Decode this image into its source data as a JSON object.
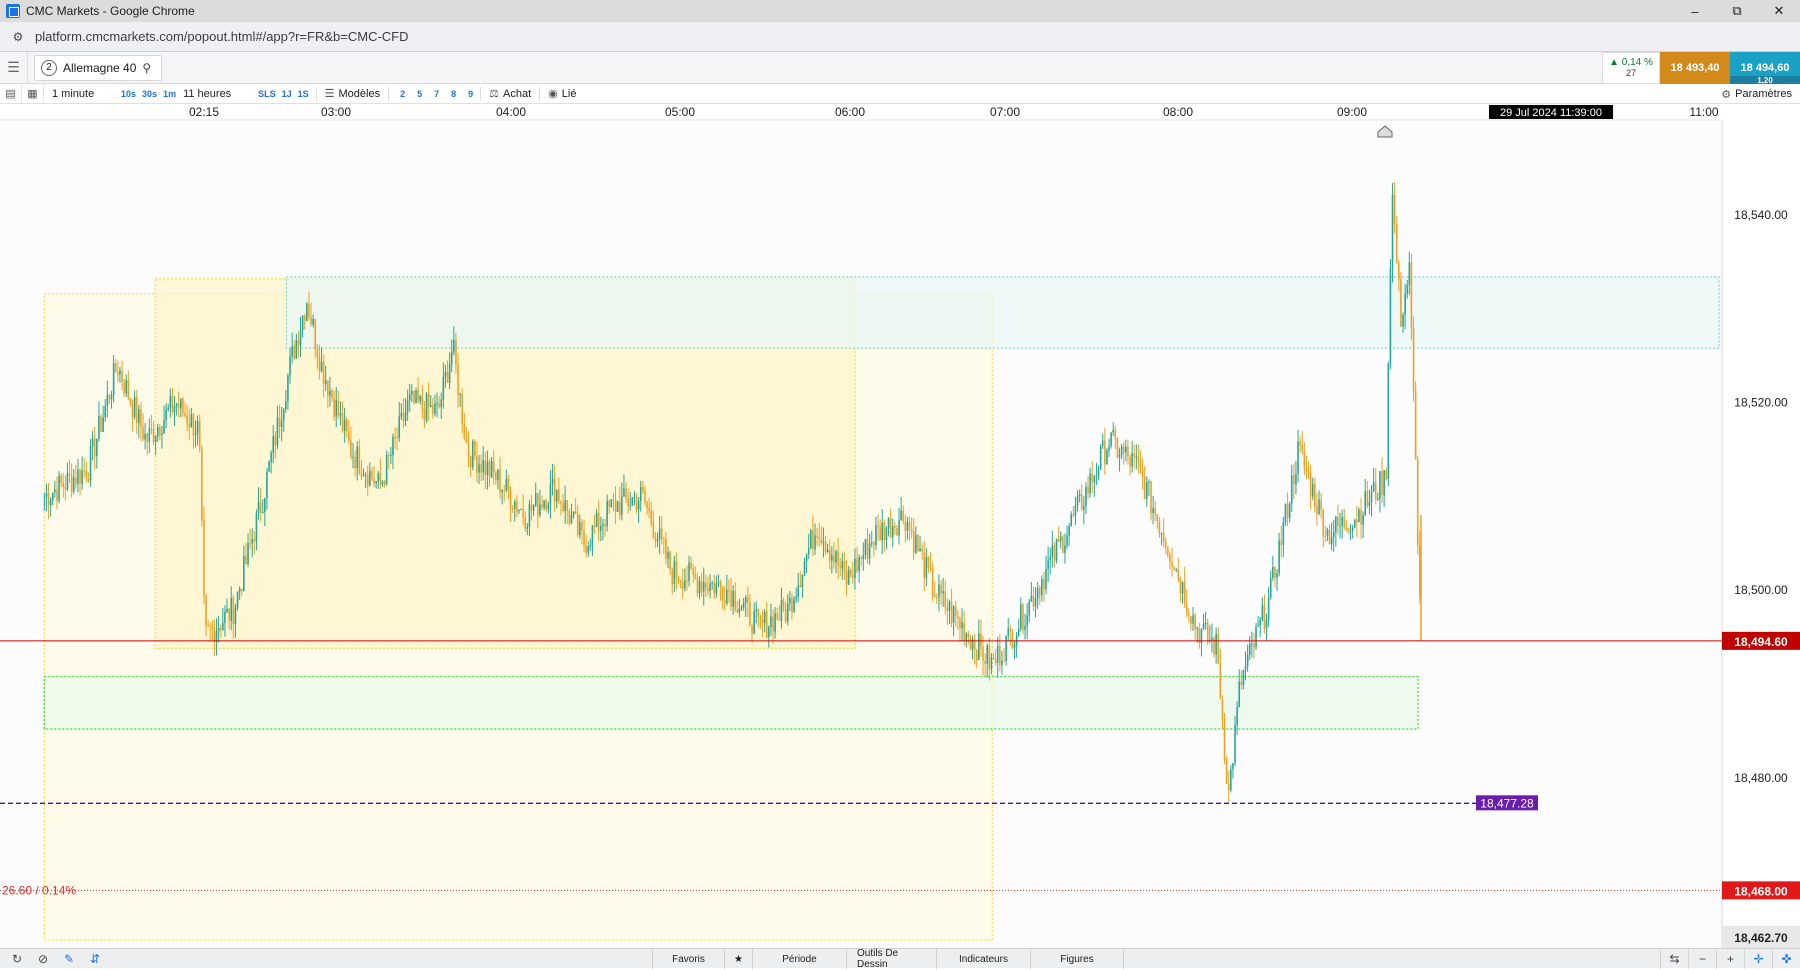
{
  "window": {
    "title": "CMC Markets - Google Chrome",
    "url": "platform.cmcmarkets.com/popout.html#/app?r=FR&b=CMC-CFD"
  },
  "instrument": {
    "tab_number": "2",
    "name": "Allemagne 40",
    "change_pct": "▲ 0,14 %",
    "change_pts": "27",
    "sell_price": "18 493,40",
    "buy_price": "18 494,60",
    "spread": "1,20"
  },
  "toolbar": {
    "interval": "1 minute",
    "quick_intervals": [
      "10s",
      "30s",
      "1m"
    ],
    "timespan": "11 heures",
    "quick_spans": [
      "SLS",
      "1J",
      "1S"
    ],
    "templates_label": "Modèles",
    "layouts": [
      "2",
      "5",
      "7",
      "8",
      "9"
    ],
    "buy_label": "Achat",
    "linked_label": "Lié",
    "settings_label": "Paramètres"
  },
  "bottombar": {
    "tabs": [
      "Favoris",
      "Période",
      "Outils De Dessin",
      "Indicateurs",
      "Figures"
    ]
  },
  "colors": {
    "bull": "#26a69a",
    "bear": "#f0a020",
    "current_price_line": "#cc0000",
    "dashed_level": "#5a0aa0",
    "target_line": "#e03030"
  },
  "chart_data": {
    "type": "candlestick",
    "x_ticks": [
      "02:15",
      "03:00",
      "04:00",
      "05:00",
      "06:00",
      "07:00",
      "08:00",
      "09:00",
      "11:00"
    ],
    "crosshair_time": "29 Jul 2024 11:39:00",
    "y_ticks": [
      "18,540.00",
      "18,520.00",
      "18,500.00",
      "18,480.00"
    ],
    "ylim": [
      18462.7,
      18549.4
    ],
    "current_price": "18,494.60",
    "current_price_value": 18494.6,
    "dashed_level": "18,477.28",
    "dashed_level_value": 18477.28,
    "target_level": "18,468.00",
    "target_level_value": 18468.0,
    "bottom_price": "18,462.70",
    "distance_label": "26.60 / 0.14%",
    "zones": [
      {
        "name": "yellow-outer",
        "from_time": "01:20",
        "to_time": "06:45",
        "top": 18531.6,
        "bottom": 18462.7,
        "color": "#fffbe5",
        "border": "#f2dc44"
      },
      {
        "name": "yellow-inner",
        "from_time": "01:58",
        "to_time": "05:58",
        "top": 18533.2,
        "bottom": 18493.8,
        "color": "#fff6cc",
        "border": "#f2dc44"
      },
      {
        "name": "cyan",
        "from_time": "02:43",
        "to_time": "11:00",
        "top": 18533.4,
        "bottom": 18525.8,
        "color": "#e8f7f6",
        "border": "#7fd3d0"
      },
      {
        "name": "green",
        "from_time": "01:20",
        "to_time": "09:11",
        "top": 18490.8,
        "bottom": 18485.2,
        "color": "#e9f9e9",
        "border": "#3dd43d"
      }
    ],
    "candles_anchor": [
      [
        "01:20",
        18510
      ],
      [
        "01:35",
        18513
      ],
      [
        "01:45",
        18524
      ],
      [
        "01:55",
        18516
      ],
      [
        "02:05",
        18520
      ],
      [
        "02:13",
        18517
      ],
      [
        "02:15",
        18495
      ],
      [
        "02:25",
        18498
      ],
      [
        "02:35",
        18510
      ],
      [
        "02:45",
        18525
      ],
      [
        "02:50",
        18531
      ],
      [
        "02:55",
        18524
      ],
      [
        "03:05",
        18515
      ],
      [
        "03:15",
        18511
      ],
      [
        "03:25",
        18520
      ],
      [
        "03:35",
        18519
      ],
      [
        "03:40",
        18526
      ],
      [
        "03:45",
        18515
      ],
      [
        "03:55",
        18512
      ],
      [
        "04:05",
        18508
      ],
      [
        "04:15",
        18511
      ],
      [
        "04:25",
        18505
      ],
      [
        "04:35",
        18509
      ],
      [
        "04:45",
        18510
      ],
      [
        "04:55",
        18502
      ],
      [
        "05:05",
        18501
      ],
      [
        "05:15",
        18500
      ],
      [
        "05:25",
        18496
      ],
      [
        "05:35",
        18498
      ],
      [
        "05:45",
        18507
      ],
      [
        "05:55",
        18501
      ],
      [
        "06:05",
        18506
      ],
      [
        "06:15",
        18508
      ],
      [
        "06:25",
        18500
      ],
      [
        "06:35",
        18496
      ],
      [
        "06:45",
        18492
      ],
      [
        "06:55",
        18497
      ],
      [
        "07:05",
        18503
      ],
      [
        "07:15",
        18509
      ],
      [
        "07:25",
        18516
      ],
      [
        "07:35",
        18513
      ],
      [
        "07:45",
        18505
      ],
      [
        "07:55",
        18496
      ],
      [
        "08:02",
        18494
      ],
      [
        "08:06",
        18478
      ],
      [
        "08:10",
        18490
      ],
      [
        "08:20",
        18499
      ],
      [
        "08:30",
        18515
      ],
      [
        "08:40",
        18506
      ],
      [
        "08:50",
        18508
      ],
      [
        "09:00",
        18512
      ],
      [
        "09:02",
        18543
      ],
      [
        "09:05",
        18529
      ],
      [
        "09:08",
        18534
      ],
      [
        "09:10",
        18515
      ],
      [
        "09:12",
        18494.6
      ]
    ]
  }
}
